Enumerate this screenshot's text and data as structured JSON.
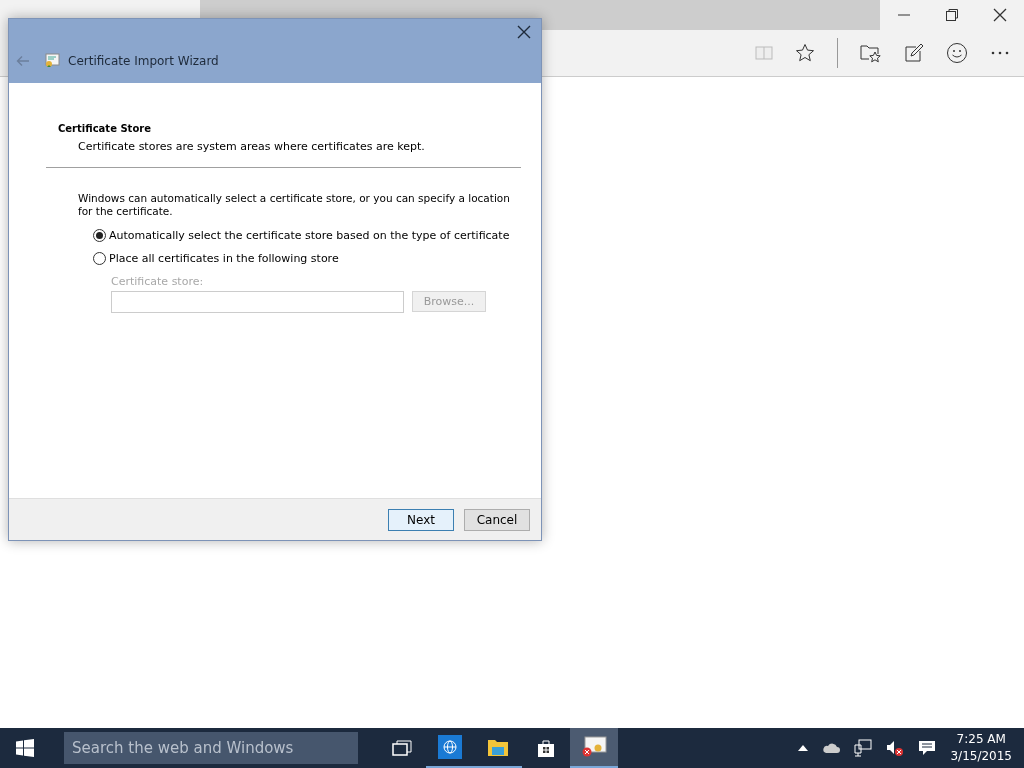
{
  "dialog": {
    "title": "Certificate Import Wizard",
    "heading": "Certificate Store",
    "subheading": "Certificate stores are system areas where certificates are kept.",
    "description": "Windows can automatically select a certificate store, or you can specify a location for the certificate.",
    "options": [
      {
        "label": "Automatically select the certificate store based on the type of certificate",
        "selected": true
      },
      {
        "label": "Place all certificates in the following store",
        "selected": false
      }
    ],
    "store": {
      "label": "Certificate store:",
      "disabled": true,
      "browse": "Browse..."
    },
    "buttons": [
      {
        "label": "Next",
        "default": true
      },
      {
        "label": "Cancel",
        "default": false
      }
    ]
  },
  "taskbar": {
    "search": {
      "placeholder": "Search the web and Windows"
    },
    "apps": [
      {
        "kind": "taskview",
        "running": false,
        "selected": false
      },
      {
        "kind": "browser",
        "running": true,
        "selected": false
      },
      {
        "kind": "folder",
        "running": true,
        "selected": false
      },
      {
        "kind": "store",
        "running": false,
        "selected": false
      },
      {
        "kind": "certificate",
        "running": true,
        "selected": true
      }
    ],
    "clock": {
      "time": "7:25 AM",
      "date": "3/15/2015"
    }
  }
}
